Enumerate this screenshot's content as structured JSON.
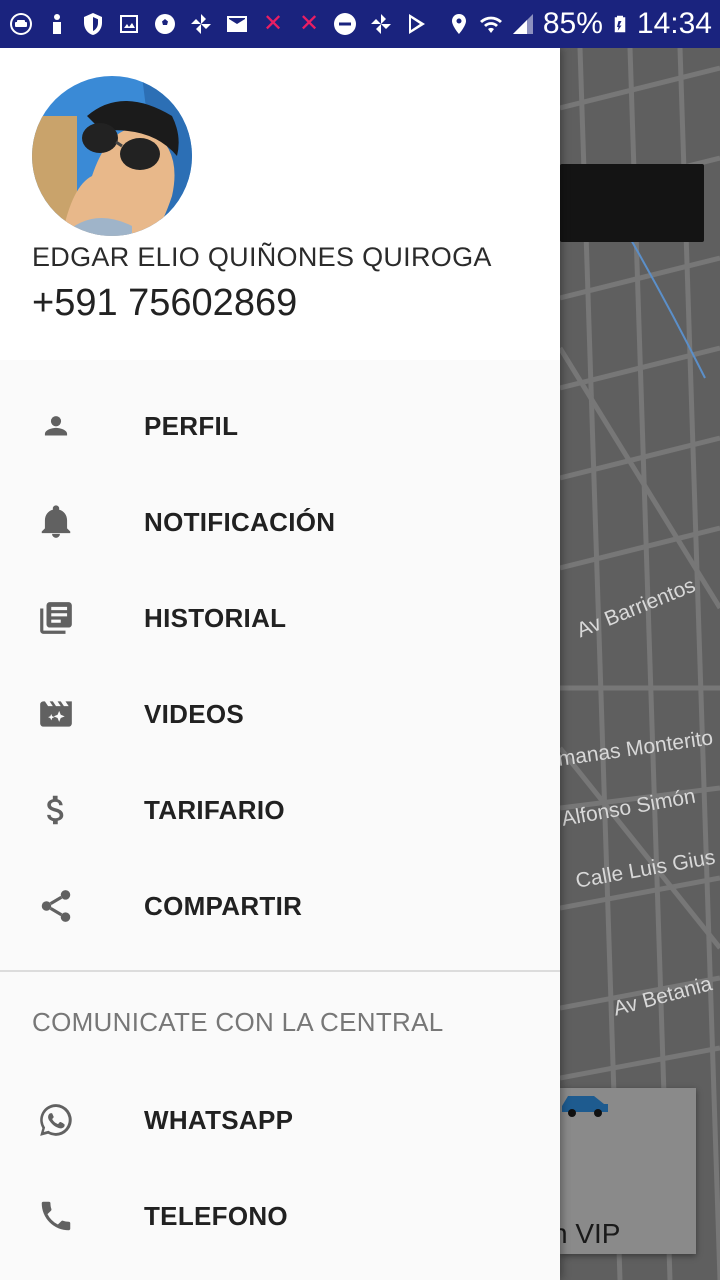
{
  "status_bar": {
    "battery": "85%",
    "time": "14:34",
    "left_icons": [
      "car-app-icon",
      "person-icon",
      "shield-icon",
      "image-icon",
      "soccer-icon",
      "pinwheel-icon",
      "mail-icon",
      "close-x-icon",
      "close-x-icon",
      "do-not-disturb-icon",
      "pinwheel-icon",
      "play-store-icon"
    ],
    "right_icons": [
      "location-icon",
      "wifi-icon",
      "signal-icon",
      "battery-icon"
    ]
  },
  "drawer": {
    "header": {
      "name": "EDGAR ELIO QUIÑONES QUIROGA",
      "phone": "+591 75602869"
    },
    "menu": [
      {
        "label": "PERFIL",
        "icon": "person-icon"
      },
      {
        "label": "NOTIFICACIÓN",
        "icon": "bell-icon"
      },
      {
        "label": "HISTORIAL",
        "icon": "history-icon"
      },
      {
        "label": "VIDEOS",
        "icon": "video-icon"
      },
      {
        "label": "TARIFARIO",
        "icon": "dollar-icon"
      },
      {
        "label": "COMPARTIR",
        "icon": "share-icon"
      }
    ],
    "section_title": "COMUNICATE CON LA CENTRAL",
    "contact": [
      {
        "label": "WHATSAPP",
        "icon": "whatsapp-icon"
      },
      {
        "label": "TELEFONO",
        "icon": "phone-icon"
      }
    ]
  },
  "map": {
    "streets": [
      "Av Barrientos",
      "manas Monterito",
      "Alfonso Simón",
      "Calle Luis Gius",
      "Av Betania"
    ],
    "card_label": "n VIP"
  },
  "colors": {
    "status_bar": "#1a237e",
    "drawer_bg": "#fafafa",
    "icon": "#616161",
    "map_bg": "#5f5f5f"
  }
}
